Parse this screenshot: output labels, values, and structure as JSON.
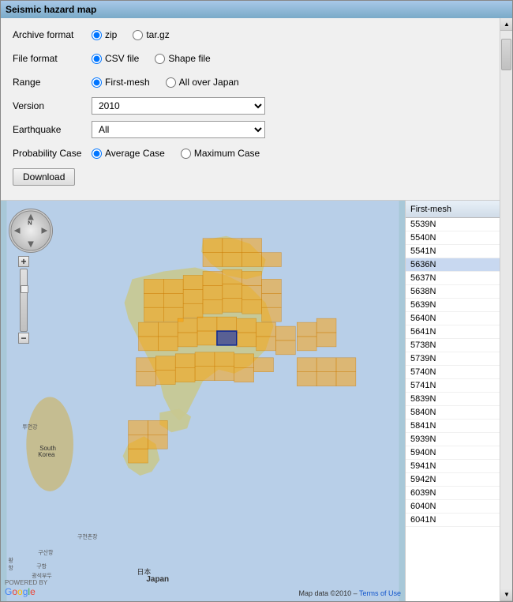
{
  "window": {
    "title": "Seismic hazard map"
  },
  "controls": {
    "archive_format_label": "Archive format",
    "file_format_label": "File format",
    "range_label": "Range",
    "version_label": "Version",
    "earthquake_label": "Earthquake",
    "probability_label": "Probability Case",
    "archive_options": [
      {
        "label": "zip",
        "value": "zip",
        "selected": true
      },
      {
        "label": "tar.gz",
        "value": "targz",
        "selected": false
      }
    ],
    "file_options": [
      {
        "label": "CSV file",
        "value": "csv",
        "selected": true
      },
      {
        "label": "Shape file",
        "value": "shape",
        "selected": false
      }
    ],
    "range_options": [
      {
        "label": "First-mesh",
        "value": "first",
        "selected": true
      },
      {
        "label": "All over Japan",
        "value": "all",
        "selected": false
      }
    ],
    "version_value": "2010",
    "earthquake_value": "All",
    "probability_options": [
      {
        "label": "Average Case",
        "value": "average",
        "selected": true
      },
      {
        "label": "Maximum Case",
        "value": "maximum",
        "selected": false
      }
    ],
    "download_label": "Download"
  },
  "list": {
    "header": "First-mesh",
    "items": [
      "5539N",
      "5540N",
      "5541N",
      "5636N",
      "5637N",
      "5638N",
      "5639N",
      "5640N",
      "5641N",
      "5738N",
      "5739N",
      "5740N",
      "5741N",
      "5839N",
      "5840N",
      "5841N",
      "5939N",
      "5940N",
      "5941N",
      "5942N",
      "6039N",
      "6040N",
      "6041N"
    ],
    "selected_item": "5636N"
  },
  "map": {
    "japan_label": "Japan",
    "japan_label_ruby": "日本",
    "south_korea_label": "South Korea",
    "powered_by": "POWERED BY",
    "google_label": "Google",
    "footer_text": "Map data ©2010",
    "terms_text": "Terms of Use"
  },
  "icons": {
    "north_arrow": "↑",
    "nav_up": "▲",
    "nav_down": "▼",
    "nav_left": "◄",
    "nav_right": "►",
    "zoom_in": "+",
    "zoom_out": "−",
    "scroll_up": "▲",
    "scroll_down": "▼",
    "list_scroll_up": "▲",
    "list_scroll_down": "▼"
  }
}
